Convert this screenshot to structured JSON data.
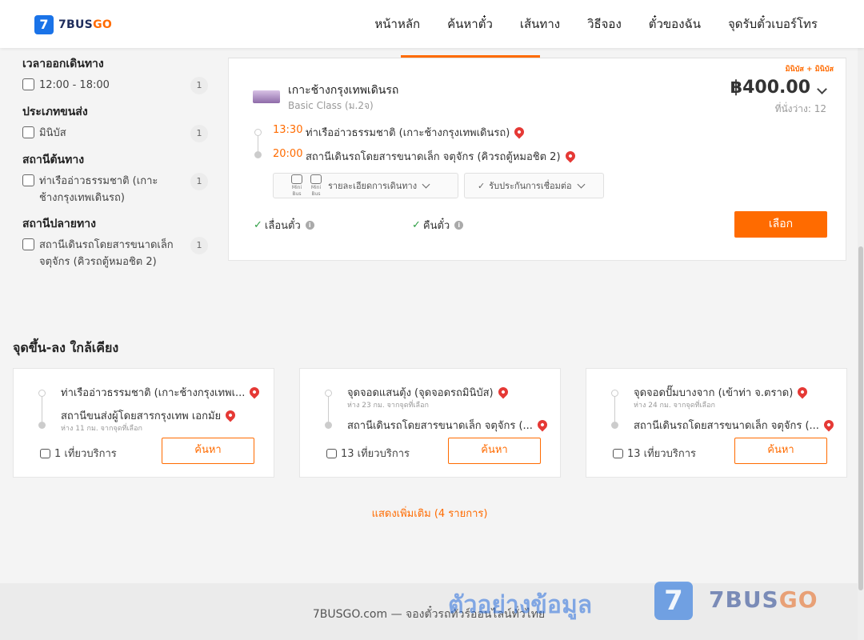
{
  "header": {
    "logo_mark": "7",
    "logo_brand": "7BUS",
    "logo_accent": "GO",
    "nav": [
      "หน้าหลัก",
      "ค้นหาตั๋ว",
      "เส้นทาง",
      "วิธีจอง",
      "ตั๋วของฉัน",
      "จุดรับตั๋วเบอร์โทร"
    ]
  },
  "filters": [
    {
      "title": "เวลาออกเดินทาง",
      "options": [
        {
          "label": "12:00 - 18:00",
          "count": "1"
        }
      ]
    },
    {
      "title": "ประเภทขนส่ง",
      "options": [
        {
          "label": "มินิบัส",
          "count": "1"
        }
      ]
    },
    {
      "title": "สถานีต้นทาง",
      "options": [
        {
          "label": "ท่าเรืออ่าวธรรมชาติ (เกาะช้างกรุงเทพเดินรถ)",
          "count": "1"
        }
      ]
    },
    {
      "title": "สถานีปลายทาง",
      "options": [
        {
          "label": "สถานีเดินรถโดยสารขนาดเล็ก จตุจักร (คิวรถตู้หมอชิต 2)",
          "count": "1"
        }
      ]
    }
  ],
  "result": {
    "vehicle_type": "มินิบัส + มินิบัส",
    "operator": "เกาะช้างกรุงเทพเดินรถ",
    "class": "Basic Class (ม.2จ)",
    "price": "฿400.00",
    "seats": "ที่นั่งว่าง: 12",
    "depart_time": "13:30",
    "depart_stop": "ท่าเรืออ่าวธรรมชาติ (เกาะช้างกรุงเทพเดินรถ)",
    "arrive_time": "20:00",
    "arrive_stop": "สถานีเดินรถโดยสารขนาดเล็ก จตุจักร (คิวรถตู้หมอชิต 2)",
    "mini_bus_label": "Mini Bus",
    "details_label": "รายละเอียดการเดินทาง",
    "guarantee_label": "รับประกันการเชื่อมต่อ",
    "reschedule_label": "เลื่อนตั๋ว",
    "refund_label": "คืนตั๋ว",
    "select_label": "เลือก",
    "check_mark": "✓",
    "info_mark": "i"
  },
  "nearby": {
    "title": "จุดขึ้น-ลง ใกล้เคียง",
    "cards": [
      {
        "from": "ท่าเรืออ่าวธรรมชาติ (เกาะช้างกรุงเทพเ...",
        "from_dist": "",
        "to": "สถานีขนส่งผู้โดยสารกรุงเทพ เอกมัย",
        "to_dist": "ห่าง 11 กม. จากจุดที่เลือก",
        "trips": "1 เที่ยวบริการ",
        "search": "ค้นหา"
      },
      {
        "from": "จุดจอดแสนตุ้ง (จุดจอดรถมินิบัส)",
        "from_dist": "ห่าง 23 กม. จากจุดที่เลือก",
        "to": "สถานีเดินรถโดยสารขนาดเล็ก จตุจักร (...",
        "to_dist": "",
        "trips": "13 เที่ยวบริการ",
        "search": "ค้นหา"
      },
      {
        "from": "จุดจอดปั๊มบางจาก (เข้าท่า จ.ตราด)",
        "from_dist": "ห่าง 24 กม. จากจุดที่เลือก",
        "to": "สถานีเดินรถโดยสารขนาดเล็ก จตุจักร (...",
        "to_dist": "",
        "trips": "13 เที่ยวบริการ",
        "search": "ค้นหา"
      }
    ],
    "show_more": "แสดงเพิ่มเติม (4 รายการ)"
  },
  "footer": {
    "text": "7BUSGO.com — จองตั๋วรถทัวร์ออนไลน์ทั่วไทย"
  },
  "watermark": {
    "text": "ตัวอย่างข้อมูล",
    "mark": "7",
    "brand": "7BUS",
    "accent": "GO"
  },
  "colors": {
    "accent": "#ff6b00",
    "brand_blue": "#1a73e8",
    "check_green": "#2e9e44",
    "pin_red": "#e53935"
  }
}
